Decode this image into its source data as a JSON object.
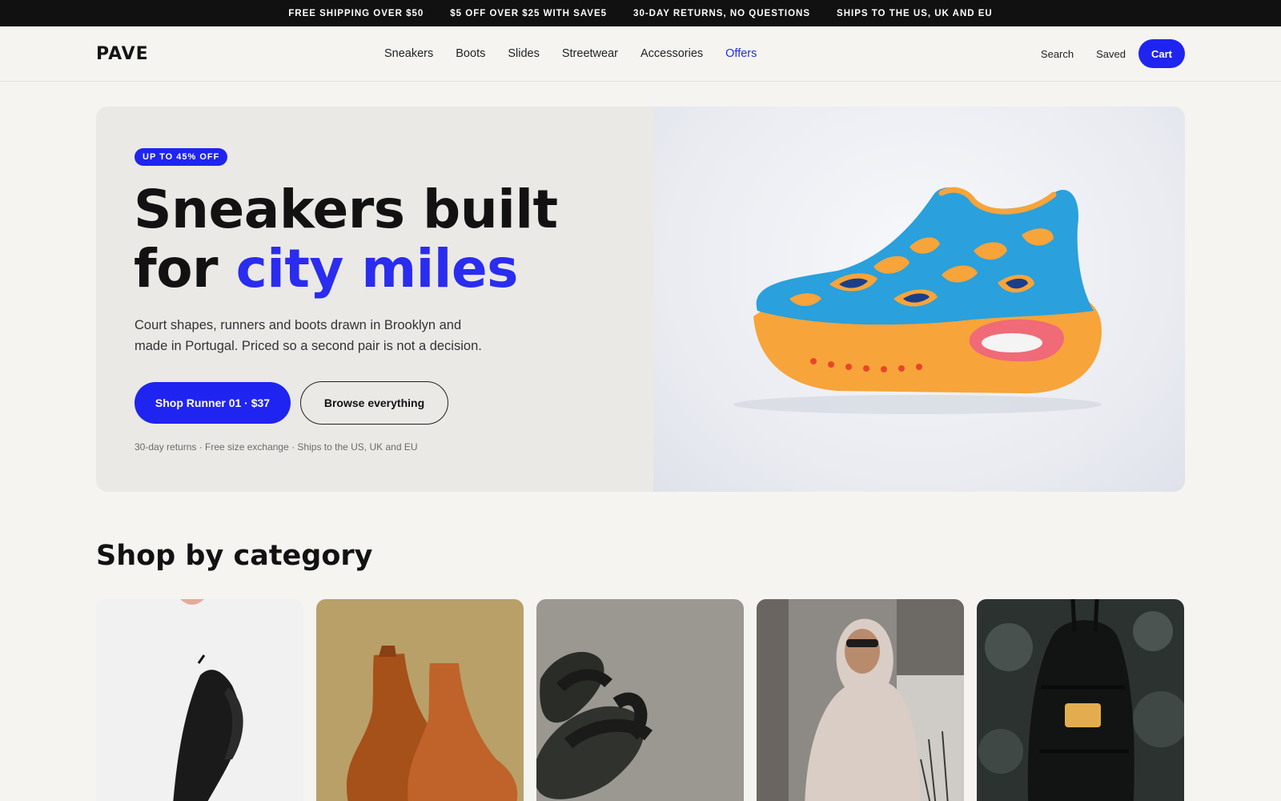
{
  "announcement": [
    "FREE SHIPPING OVER $50",
    "$5 OFF OVER $25 WITH SAVE5",
    "30-DAY RETURNS, NO QUESTIONS",
    "SHIPS TO THE US, UK AND EU"
  ],
  "brand": {
    "logo": "PAVE"
  },
  "nav": {
    "links": [
      {
        "label": "Sneakers"
      },
      {
        "label": "Boots"
      },
      {
        "label": "Slides"
      },
      {
        "label": "Streetwear"
      },
      {
        "label": "Accessories"
      },
      {
        "label": "Offers",
        "highlight": true
      }
    ],
    "search_label": "Search",
    "saved_label": "Saved",
    "cart_label": "Cart"
  },
  "hero": {
    "badge": "UP TO 45% OFF",
    "headline_line1": "Sneakers built",
    "headline_line2_prefix": "for ",
    "headline_line2_accent": "city miles",
    "subtext": "Court shapes, runners and boots drawn in Brooklyn and made in Portugal. Priced so a second pair is not a decision.",
    "primary_cta": "Shop Runner 01 · $37",
    "secondary_cta": "Browse everything",
    "fineprint": "30-day returns · Free size exchange · Ships to the US, UK and EU"
  },
  "categories_section": {
    "title": "Shop by category",
    "cards": [
      {
        "image": "black-sneaker-photo"
      },
      {
        "image": "brown-brogue-boots-photo"
      },
      {
        "image": "black-slides-photo"
      },
      {
        "image": "hoodie-streetwear-photo"
      },
      {
        "image": "black-backpack-photo"
      }
    ]
  },
  "colors": {
    "accent": "#1f24f0",
    "topbar": "#111111",
    "background": "#f5f4f1"
  }
}
